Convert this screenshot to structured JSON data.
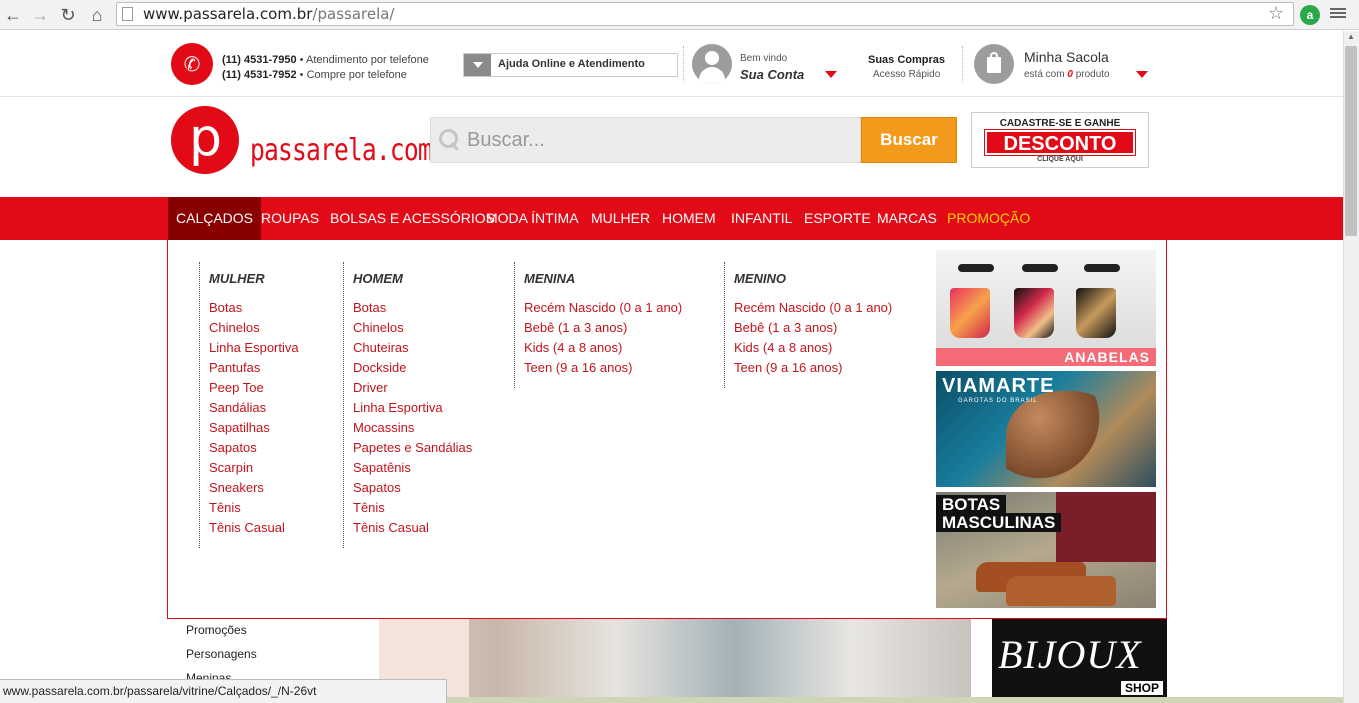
{
  "browser": {
    "url_domain": "www.passarela.com.br",
    "url_path": "/passarela/",
    "status_url": "www.passarela.com.br/passarela/vitrine/Calçados/_/N-26vt"
  },
  "topbar": {
    "phone1_number": "(11) 4531-7950",
    "phone1_desc": " • Atendimento por telefone",
    "phone2_number": "(11) 4531-7952",
    "phone2_desc": " • Compre por telefone",
    "help_label": "Ajuda Online e Atendimento",
    "welcome": "Bem vindo",
    "account": "Sua Conta",
    "purchases_title": "Suas Compras",
    "purchases_sub": "Acesso Rápido",
    "bag_title": "Minha Sacola",
    "bag_prefix": "está com ",
    "bag_count": "0",
    "bag_suffix": "  produto"
  },
  "header": {
    "logo_letter": "p",
    "logo_text": "passarela.com",
    "search_placeholder": "Buscar...",
    "search_button": "Buscar",
    "promo_line1": "CADASTRE-SE E GANHE",
    "promo_line2": "DESCONTO",
    "promo_line3": "CLIQUE AQUI"
  },
  "nav": {
    "items": [
      "CALÇADOS",
      "ROUPAS",
      "BOLSAS E ACESSÓRIOS",
      "MODA ÍNTIMA",
      "MULHER",
      "HOMEM",
      "INFANTIL",
      "ESPORTE",
      "MARCAS",
      "PROMOÇÃO"
    ]
  },
  "dropdown": {
    "columns": [
      {
        "title": "MULHER",
        "items": [
          "Botas",
          "Chinelos",
          "Linha Esportiva",
          "Pantufas",
          "Peep Toe",
          "Sandálias",
          "Sapatilhas",
          "Sapatos",
          "Scarpin",
          "Sneakers",
          "Tênis",
          "Tênis Casual"
        ]
      },
      {
        "title": "HOMEM",
        "items": [
          "Botas",
          "Chinelos",
          "Chuteiras",
          "Dockside",
          "Driver",
          "Linha Esportiva",
          "Mocassins",
          "Papetes e Sandálias",
          "Sapatênis",
          "Sapatos",
          "Tênis",
          "Tênis Casual"
        ]
      },
      {
        "title": "MENINA",
        "items": [
          "Recém Nascido (0 a 1 ano)",
          "Bebê (1 a 3 anos)",
          "Kids (4 a 8 anos)",
          "Teen (9 a 16 anos)"
        ]
      },
      {
        "title": "MENINO",
        "items": [
          "Recém Nascido (0 a 1 ano)",
          "Bebê (1 a 3 anos)",
          "Kids (4 a 8 anos)",
          "Teen (9 a 16 anos)"
        ]
      }
    ],
    "banners": {
      "anabelas": "ANABELAS",
      "viamarte_brand": "VIAMARTE",
      "viamarte_sub": "GAROTAS DO BRASIL",
      "botas_line1": "BOTAS",
      "botas_line2": "MASCULINAS"
    }
  },
  "background": {
    "sidebar_links": [
      "Promoções",
      "Personagens",
      "Meninas"
    ],
    "bijoux": "BIJOUX",
    "shop": "SHOP"
  },
  "colors": {
    "brand_red": "#e20a16",
    "nav_active": "#8a0000",
    "promo_yellow": "#ffd200",
    "search_orange": "#f39a1d",
    "link_red": "#c3141c"
  }
}
